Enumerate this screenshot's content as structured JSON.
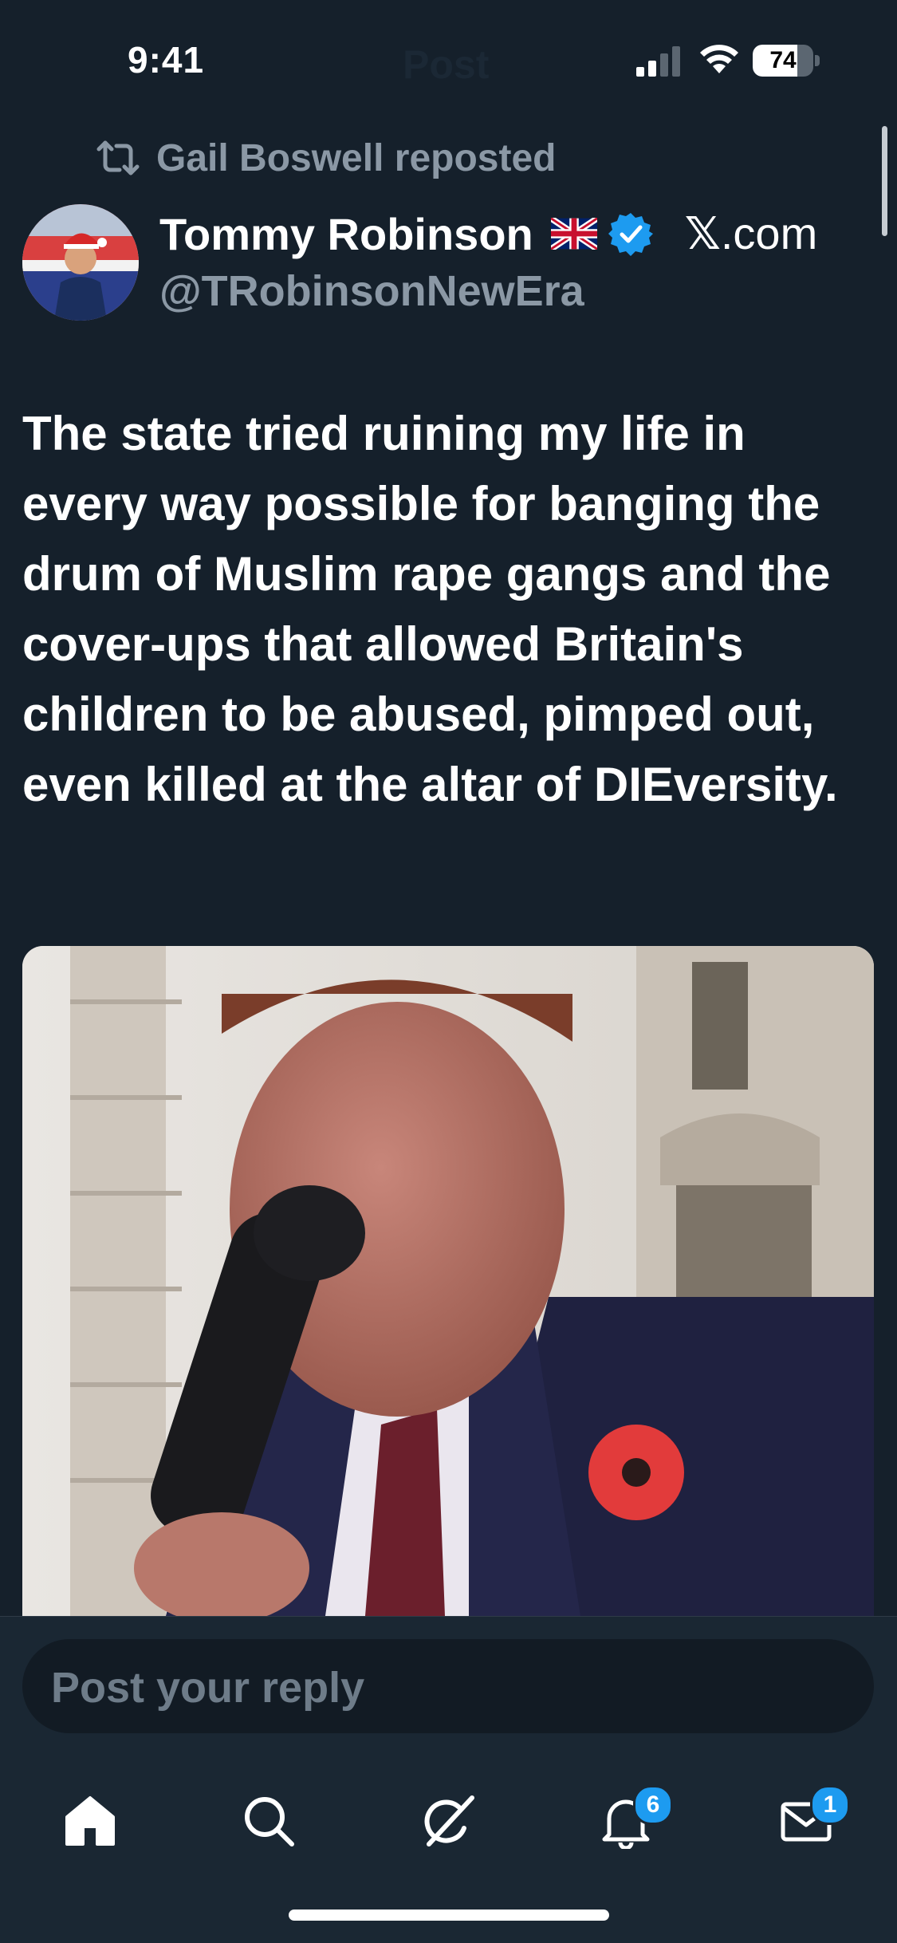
{
  "status_bar": {
    "time": "9:41",
    "battery": "74",
    "battery_level": 0.74,
    "ghost_title": "Post"
  },
  "repost": {
    "text": "Gail Boswell reposted"
  },
  "author": {
    "name": "Tommy Robinson",
    "handle": "@TRobinsonNewEra",
    "source_x": "𝕏",
    "source_rest": ".com",
    "verified_color": "#1d9bf0"
  },
  "tweet": {
    "text": "The state tried ruining my life in every way possible for banging the drum of Muslim rape gangs and the cover-ups that allowed Britain's children to be abused, pimped out, even killed at the altar of DIEversity."
  },
  "reply": {
    "placeholder": "Post your reply"
  },
  "tabs": [
    {
      "name": "home",
      "icon": "home-icon",
      "badge": ""
    },
    {
      "name": "search",
      "icon": "search-icon",
      "badge": ""
    },
    {
      "name": "grok",
      "icon": "grok-icon",
      "badge": ""
    },
    {
      "name": "notifications",
      "icon": "bell-icon",
      "badge": "6"
    },
    {
      "name": "messages",
      "icon": "envelope-icon",
      "badge": "1"
    }
  ],
  "colors": {
    "background": "#15202b",
    "secondary_text": "#8b98a5",
    "accent": "#1d9bf0"
  }
}
